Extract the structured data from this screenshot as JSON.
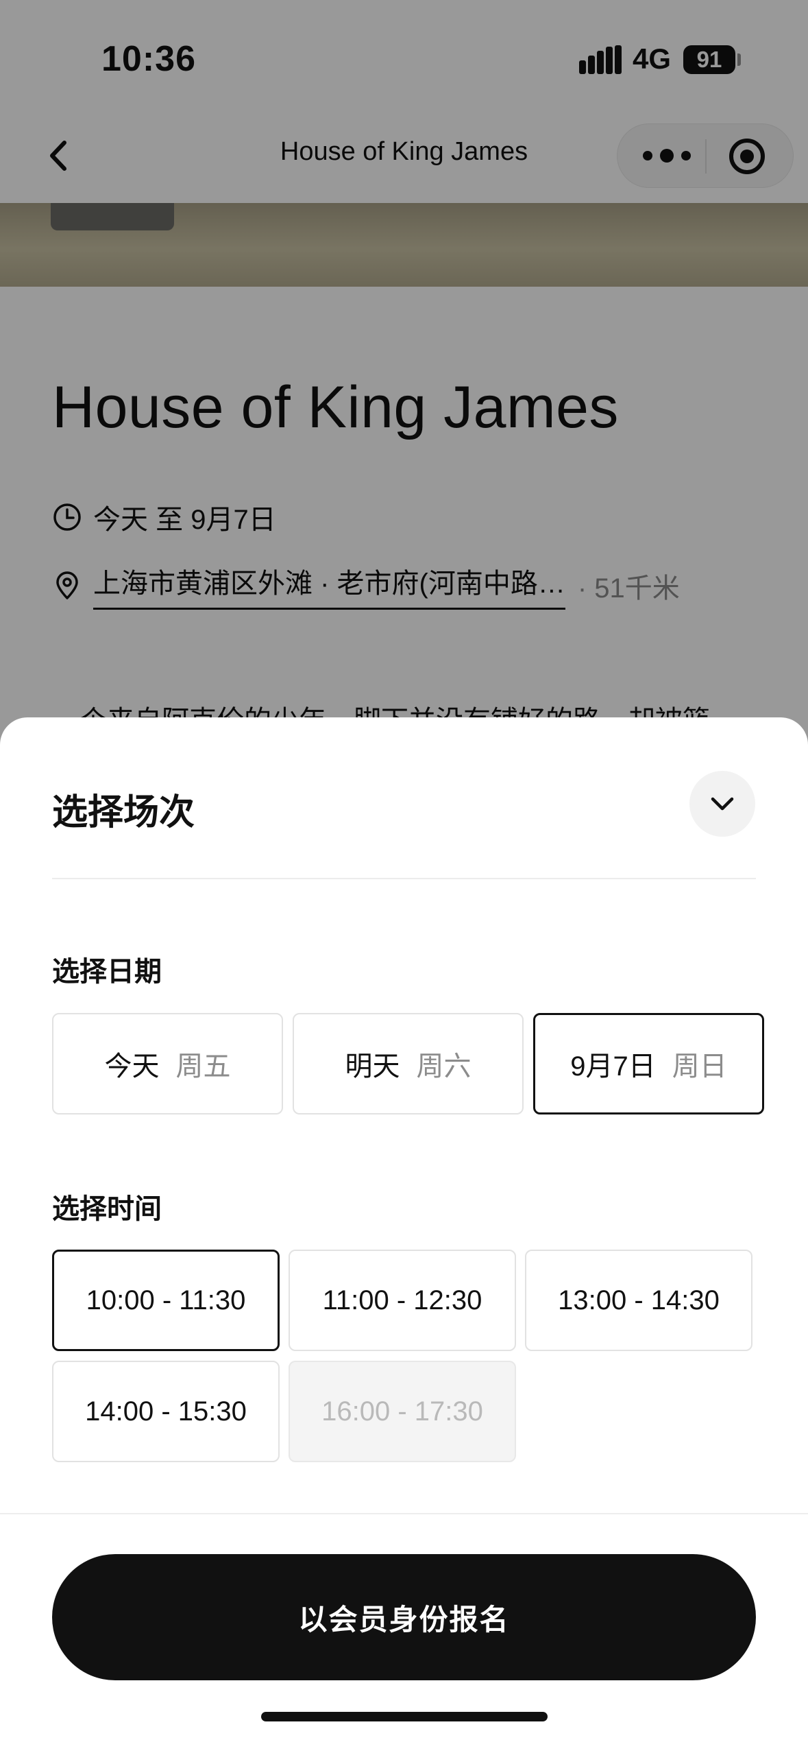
{
  "status_bar": {
    "time": "10:36",
    "network": "4G",
    "battery": "91"
  },
  "nav": {
    "title": "House of King James",
    "back_icon": "chevron-left-icon",
    "more_icon": "more-dots-icon",
    "close_icon": "target-close-icon"
  },
  "event": {
    "title": "House of King James",
    "date_range": "今天 至 9月7日",
    "location": "上海市黄浦区外滩 · 老市府(河南中路…",
    "distance": "· 51千米",
    "description": "一个来自阿克伦的少年，脚下并没有铺好的路，却被篮"
  },
  "sheet": {
    "title": "选择场次",
    "date_label": "选择日期",
    "time_label": "选择时间",
    "dates": [
      {
        "day": "今天",
        "weekday": "周五",
        "selected": false
      },
      {
        "day": "明天",
        "weekday": "周六",
        "selected": false
      },
      {
        "day": "9月7日",
        "weekday": "周日",
        "selected": true
      }
    ],
    "times": [
      {
        "label": "10:00 - 11:30",
        "selected": true,
        "disabled": false
      },
      {
        "label": "11:00 - 12:30",
        "selected": false,
        "disabled": false
      },
      {
        "label": "13:00 - 14:30",
        "selected": false,
        "disabled": false
      },
      {
        "label": "14:00 - 15:30",
        "selected": false,
        "disabled": false
      },
      {
        "label": "16:00 - 17:30",
        "selected": false,
        "disabled": true
      }
    ],
    "register_label": "以会员身份报名"
  },
  "colors": {
    "accent": "#111111",
    "overlay": "rgba(0,0,0,0.4)",
    "muted_text": "#8c8c8c",
    "disabled_bg": "#f4f4f4"
  }
}
